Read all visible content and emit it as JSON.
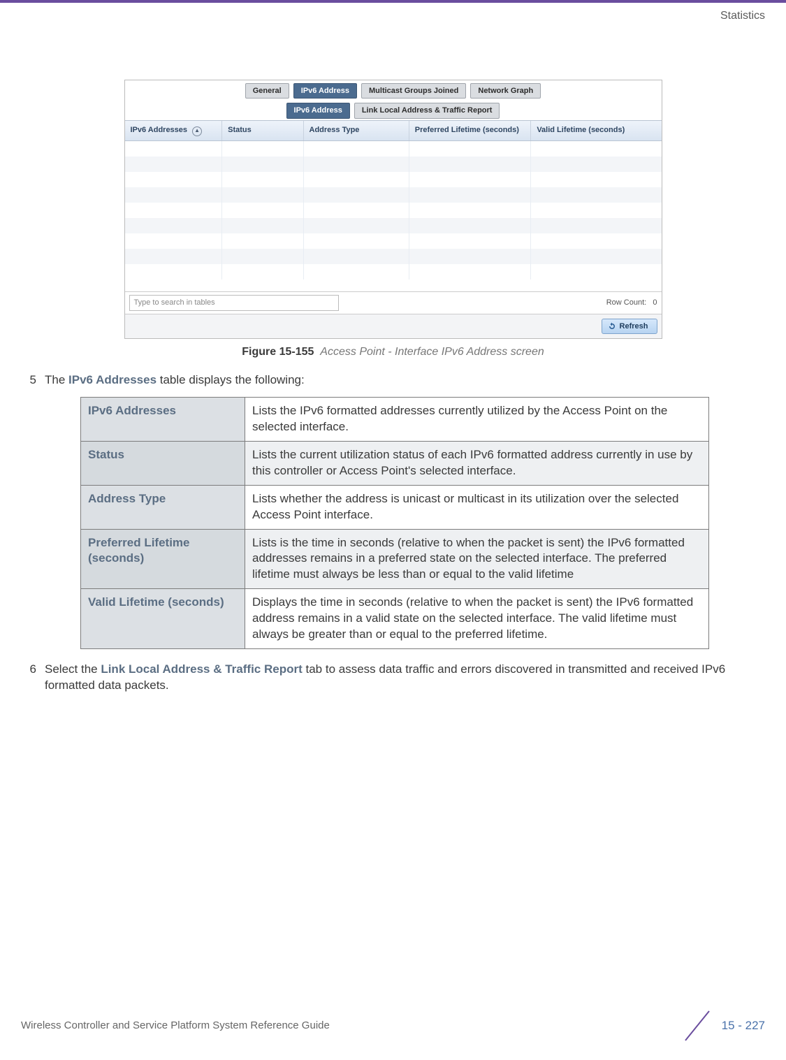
{
  "header": {
    "section": "Statistics"
  },
  "screenshot": {
    "tabs_top": {
      "general": "General",
      "ipv6": "IPv6 Address",
      "mcast": "Multicast Groups Joined",
      "netgraph": "Network Graph"
    },
    "tabs_sub": {
      "ipv6": "IPv6 Address",
      "linklocal": "Link Local Address & Traffic Report"
    },
    "columns": {
      "c1": "IPv6 Addresses",
      "c2": "Status",
      "c3": "Address Type",
      "c4": "Preferred Lifetime (seconds)",
      "c5": "Valid Lifetime (seconds)"
    },
    "search_placeholder": "Type to search in tables",
    "row_count_label": "Row Count:",
    "row_count_value": "0",
    "refresh_label": "Refresh"
  },
  "figure": {
    "label": "Figure 15-155",
    "caption": "Access Point - Interface IPv6 Address screen"
  },
  "step5": {
    "num": "5",
    "pre": "The ",
    "kw": "IPv6 Addresses",
    "post": " table displays the following:"
  },
  "defs": {
    "r1k": "IPv6 Addresses",
    "r1v": "Lists the IPv6 formatted addresses currently utilized by the Access Point on the selected interface.",
    "r2k": "Status",
    "r2v": "Lists the current utilization status of each IPv6 formatted address currently in use by this controller or Access Point's selected interface.",
    "r3k": "Address Type",
    "r3v": "Lists whether the address is unicast or multicast in its utilization over the selected Access Point interface.",
    "r4k": "Preferred Lifetime (seconds)",
    "r4v": "Lists is the time in seconds (relative to when the packet is sent) the IPv6 formatted addresses remains in a preferred state on the selected interface. The preferred lifetime must always be less than or equal to the valid lifetime",
    "r5k": "Valid Lifetime (seconds)",
    "r5v": "Displays the time in seconds (relative to when the packet is sent) the IPv6 formatted address remains in a valid state on the selected interface. The valid lifetime must always be greater than or equal to the preferred lifetime."
  },
  "step6": {
    "num": "6",
    "pre": "Select the ",
    "kw": "Link Local Address & Traffic Report",
    "post": " tab to assess data traffic and errors discovered in transmitted and received IPv6 formatted data packets."
  },
  "footer": {
    "doc": "Wireless Controller and Service Platform System Reference Guide",
    "page": "15 - 227"
  }
}
